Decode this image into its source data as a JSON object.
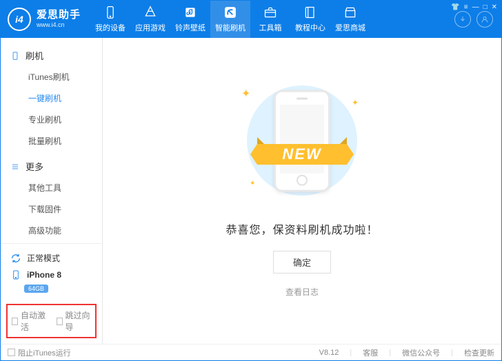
{
  "app": {
    "title": "爱思助手",
    "subtitle": "www.i4.cn"
  },
  "nav": {
    "items": [
      {
        "label": "我的设备"
      },
      {
        "label": "应用游戏"
      },
      {
        "label": "铃声壁纸"
      },
      {
        "label": "智能刷机"
      },
      {
        "label": "工具箱"
      },
      {
        "label": "教程中心"
      },
      {
        "label": "爱思商城"
      }
    ],
    "activeIndex": 3
  },
  "sidebar": {
    "groups": [
      {
        "header": "刷机",
        "items": [
          "iTunes刷机",
          "一键刷机",
          "专业刷机",
          "批量刷机"
        ],
        "activeIndex": 1
      },
      {
        "header": "更多",
        "items": [
          "其他工具",
          "下载固件",
          "高级功能"
        ],
        "activeIndex": -1
      }
    ],
    "mode": {
      "label": "正常模式"
    },
    "device": {
      "name": "iPhone 8",
      "storage": "64GB"
    },
    "checks": {
      "autoActivate": "自动激活",
      "skipGuide": "跳过向导"
    }
  },
  "main": {
    "banner": "NEW",
    "message": "恭喜您，保资料刷机成功啦！",
    "ok": "确定",
    "viewLog": "查看日志"
  },
  "status": {
    "blockItunes": "阻止iTunes运行",
    "version": "V8.12",
    "support": "客服",
    "wechat": "微信公众号",
    "update": "检查更新"
  }
}
